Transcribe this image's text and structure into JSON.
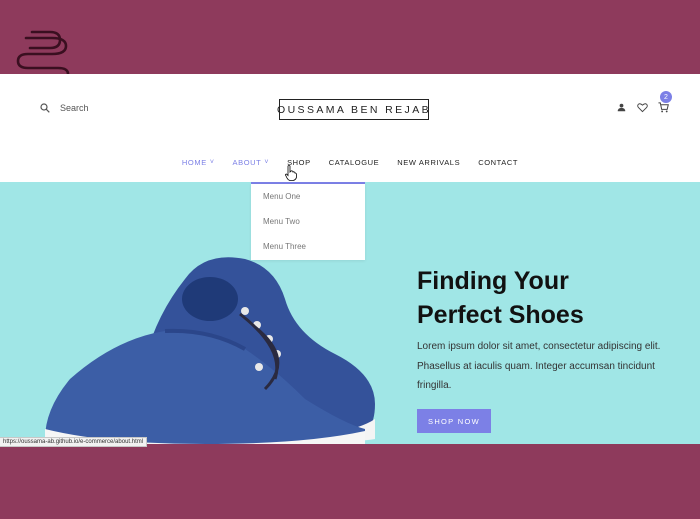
{
  "colors": {
    "frame": "#8e3a5c",
    "accent": "#7c80e6",
    "hero_bg": "#a0e6e6",
    "shoe": "#34529a"
  },
  "logo": {
    "icon": "paperclip-logo-icon"
  },
  "header": {
    "search_label": "Search",
    "search_icon": "search-icon",
    "brand": "OUSSAMA BEN REJAB",
    "cart_count": "2",
    "icons": [
      "user-icon",
      "heart-icon",
      "cart-icon"
    ]
  },
  "nav": {
    "items": [
      {
        "label": "HOME",
        "has_chevron": true,
        "active": true
      },
      {
        "label": "ABOUT",
        "has_chevron": true,
        "active": true
      },
      {
        "label": "SHOP"
      },
      {
        "label": "CATALOGUE"
      },
      {
        "label": "NEW ARRIVALS"
      },
      {
        "label": "CONTACT"
      }
    ],
    "chevron": "˅"
  },
  "dropdown": {
    "items": [
      "Menu One",
      "Menu Two",
      "Menu Three"
    ]
  },
  "hero": {
    "headline_line1": "Finding Your",
    "headline_line2": "Perfect Shoes",
    "paragraph": "Lorem ipsum dolor sit amet, consectetur adipiscing elit. Phasellus at iaculis quam. Integer accumsan tincidunt fringilla.",
    "button": "SHOP NOW"
  },
  "status_bar": {
    "url": "https://oussama-ab.github.io/e-commerce/about.html"
  }
}
